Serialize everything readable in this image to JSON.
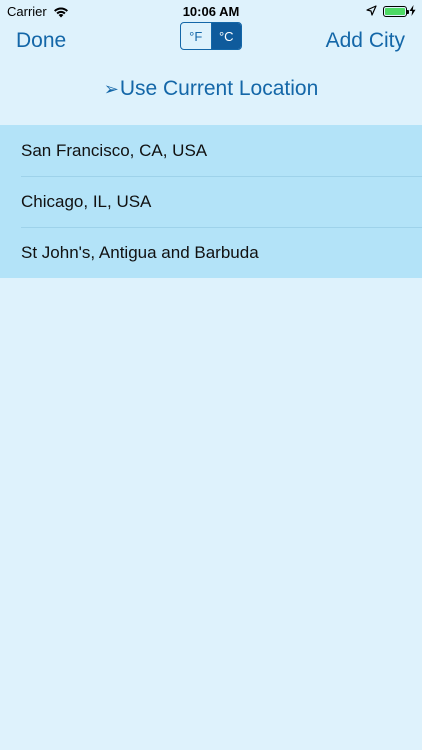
{
  "status_bar": {
    "carrier": "Carrier",
    "time": "10:06 AM",
    "wifi_icon": "wifi-icon",
    "location_icon": "location-arrow-icon",
    "battery_icon": "battery-icon",
    "charging_icon": "bolt-icon",
    "battery_level": 1.0,
    "battery_color": "#4cd964"
  },
  "nav": {
    "done_label": "Done",
    "add_city_label": "Add City",
    "units": [
      {
        "label": "°F",
        "selected": false
      },
      {
        "label": "°C",
        "selected": true
      }
    ],
    "accent_color": "#1467a8"
  },
  "location": {
    "icon": "location-arrow-icon",
    "arrow_glyph": "➢",
    "label": "Use Current Location"
  },
  "cities": [
    {
      "name": "San Francisco, CA, USA"
    },
    {
      "name": "Chicago, IL, USA"
    },
    {
      "name": "St John's, Antigua and Barbuda"
    }
  ]
}
